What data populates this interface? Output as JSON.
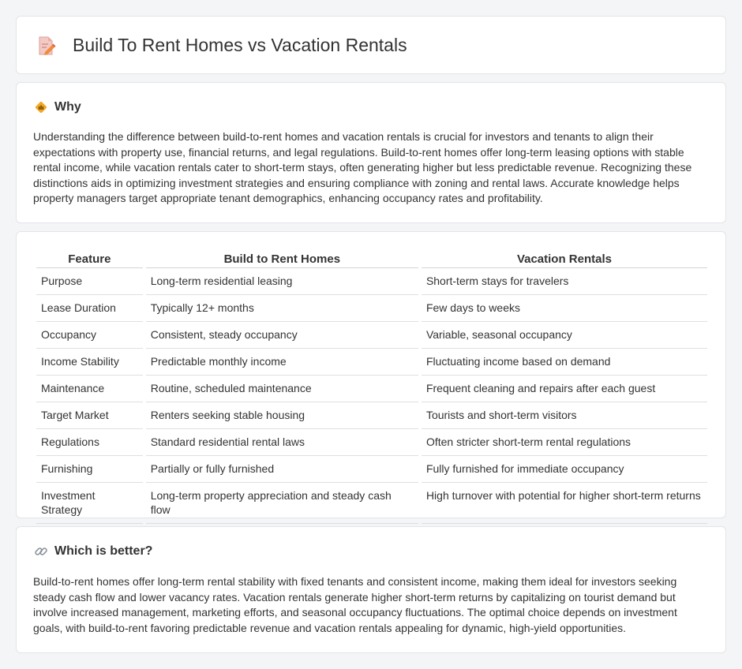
{
  "header": {
    "title": "Build To Rent Homes vs Vacation Rentals",
    "icon": "document-edit-icon"
  },
  "why": {
    "heading": "Why",
    "icon": "diamond-warning-icon",
    "text": "Understanding the difference between build-to-rent homes and vacation rentals is crucial for investors and tenants to align their expectations with property use, financial returns, and legal regulations. Build-to-rent homes offer long-term leasing options with stable rental income, while vacation rentals cater to short-term stays, often generating higher but less predictable revenue. Recognizing these distinctions aids in optimizing investment strategies and ensuring compliance with zoning and rental laws. Accurate knowledge helps property managers target appropriate tenant demographics, enhancing occupancy rates and profitability."
  },
  "table": {
    "headers": [
      "Feature",
      "Build to Rent Homes",
      "Vacation Rentals"
    ],
    "rows": [
      [
        "Purpose",
        "Long-term residential leasing",
        "Short-term stays for travelers"
      ],
      [
        "Lease Duration",
        "Typically 12+ months",
        "Few days to weeks"
      ],
      [
        "Occupancy",
        "Consistent, steady occupancy",
        "Variable, seasonal occupancy"
      ],
      [
        "Income Stability",
        "Predictable monthly income",
        "Fluctuating income based on demand"
      ],
      [
        "Maintenance",
        "Routine, scheduled maintenance",
        "Frequent cleaning and repairs after each guest"
      ],
      [
        "Target Market",
        "Renters seeking stable housing",
        "Tourists and short-term visitors"
      ],
      [
        "Regulations",
        "Standard residential rental laws",
        "Often stricter short-term rental regulations"
      ],
      [
        "Furnishing",
        "Partially or fully furnished",
        "Fully furnished for immediate occupancy"
      ],
      [
        "Investment Strategy",
        "Long-term property appreciation and steady cash flow",
        "High turnover with potential for higher short-term returns"
      ]
    ]
  },
  "better": {
    "heading": "Which is better?",
    "icon": "link-icon",
    "text": "Build-to-rent homes offer long-term rental stability with fixed tenants and consistent income, making them ideal for investors seeking steady cash flow and lower vacancy rates. Vacation rentals generate higher short-term returns by capitalizing on tourist demand but involve increased management, marketing efforts, and seasonal occupancy fluctuations. The optimal choice depends on investment goals, with build-to-rent favoring predictable revenue and vacation rentals appealing for dynamic, high-yield opportunities."
  }
}
